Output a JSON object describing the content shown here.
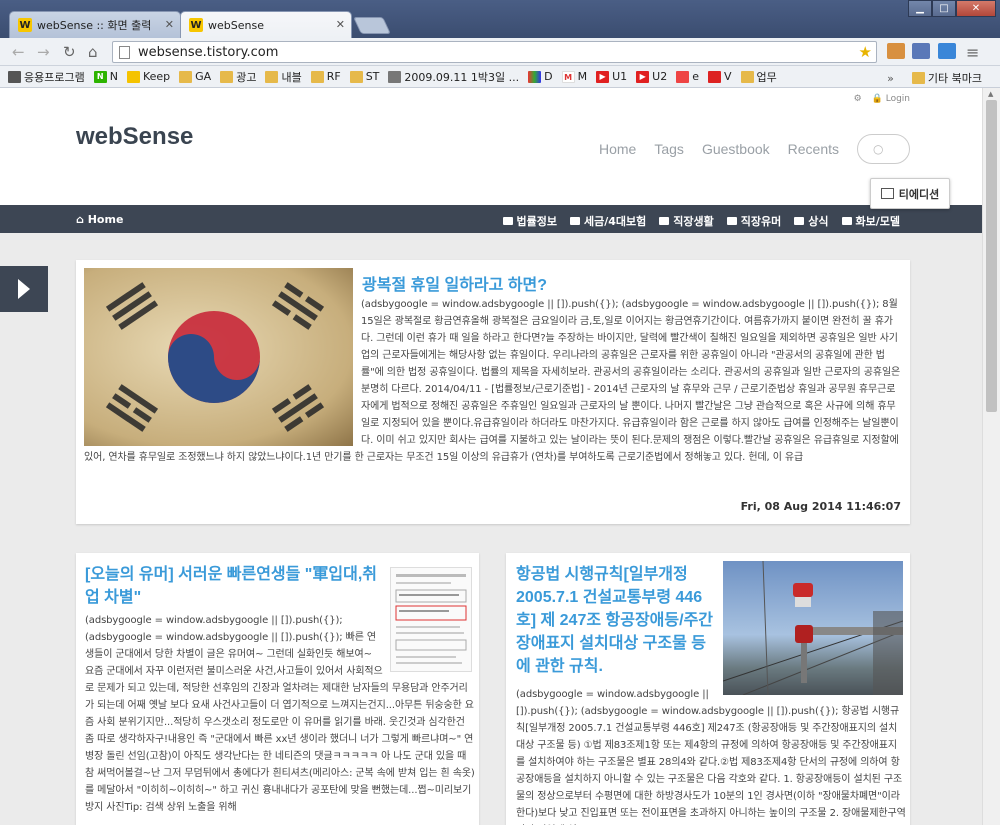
{
  "browser": {
    "tabs": [
      {
        "title": "webSense :: 화면 출력",
        "favicon": "W"
      },
      {
        "title": "webSense",
        "favicon": "W"
      }
    ],
    "url": "websense.tistory.com",
    "bookmarks": [
      "응용프로그램",
      "N",
      "Keep",
      "GA",
      "광고",
      "내블",
      "RF",
      "ST",
      "2009.09.11 1박3일 ...",
      "D",
      "M",
      "U1",
      "U2",
      "e",
      "V",
      "업무"
    ],
    "other_bookmarks": "기타 북마크"
  },
  "site": {
    "login": "Login",
    "logo": "webSense",
    "nav": [
      "Home",
      "Tags",
      "Guestbook",
      "Recents"
    ],
    "tedition": "티에디션",
    "home_link": "Home",
    "categories": [
      "법률정보",
      "세금/4대보험",
      "직장생활",
      "직장유머",
      "상식",
      "화보/모델"
    ]
  },
  "posts": [
    {
      "title": "광복절 휴일 일하라고 하면?",
      "excerpt": "(adsbygoogle = window.adsbygoogle || []).push({}); (adsbygoogle = window.adsbygoogle || []).push({}); 8월15일은 광복절로 황금연휴올해 광복절은 금요일이라 금,토,일로 이어지는 황금연휴기간이다. 여름휴가까지 붙이면 완전히 꿀 휴가다. 그런데 이런 휴가 때 일을 하라고 한다면?늘 주장하는 바이지만, 달력에 빨간색이 칠해진 일요일을 제외하면 공휴일은 일반 사기업의 근로자들에게는 해당사항 없는 휴일이다. 우리나라의 공휴일은 근로자를 위한 공휴일이 아니라 \"관공서의 공휴일에 관한 법률\"에 의한 법정 공휴일이다. 법률의 제목을 자세히보라. 관공서의 공휴일이라는 소리다. 관공서의 공휴일과 일반 근로자의 공휴일은 분명히 다르다. 2014/04/11 - [법률정보/근로기준법] - 2014년 근로자의 날 휴무와 근무 / 근로기준법상 휴일과 공무원 휴무근로자에게 법적으로 정해진 공휴일은 주휴일인 일요일과 근로자의 날 뿐이다. 나머지 빨간날은 그냥 관습적으로 혹은 사규에 의해 휴무일로 지정되어 있을 뿐이다.유급휴일이라 하더라도 마찬가지다. 유급휴일이라 함은 근로를 하지 않아도 급여를 인정해주는 날일뿐이다. 이미 쉬고 있지만 회사는 급여를 지불하고 있는 날이라는 뜻이 된다.문제의 쟁점은 이렇다.빨간날 공휴일은 유급휴일로 지정할에 있어, 연차를 휴무일로 조정했느냐 하지 않았느냐이다.1년 만기를 한 근로자는 무조건 15일 이상의 유급휴가 (연차)를 부여하도록 근로기준법에서 정해놓고 있다. 헌데, 이 유급",
      "date": "Fri, 08 Aug 2014 11:46:07"
    },
    {
      "title": "[오늘의 유머] 서러운 빠른연생들 \"軍입대,취업 차별\"",
      "excerpt": "(adsbygoogle = window.adsbygoogle || []).push({}); (adsbygoogle = window.adsbygoogle || []).push({}); 빠른 연생들이 군대에서 당한 차별이 글은 유머여~ 그런데 실화인듯 해보여~ 요즘 군대에서 자꾸 이런저런 불미스러운 사건,사고들이 있어서 사회적으로 문제가 되고 있는데, 적당한 선후임의 긴장과 얼차려는 제대한 남자들의 무용담과 안주거리가 되는데 어째 옛날 보다 요새 사건사고들이 더 엽기적으로 느껴지는건지...아무튼 뒤숭숭한 요즘 사회 분위기지만...적당히 우스갯소리 정도로만 이 유머를 읽기를 바래. 웃긴것과 심각한건 좀 따로 생각하자구!내용인 즉 \"군대에서 빠른 xx년 생이라 했더니 너가 그렇게 빠르냐며~\" 연병장 돌린 선임(고참)이 아직도 생각난다는 한 네티즌의 댓글ㅋㅋㅋㅋㅋ 아 나도 군대 있을 때 참 써먹어볼걸~난 그저 무덤뒤에서 총에다가 흰티셔츠(메리아스: 군복 속에 받쳐 입는 흰 속옷)를 메달아서 \"이히히~이히히~\" 하고 귀신 흉내내다가 공포탄에 맞을 뻔했는데...쩝~미리보기 방지 사진Tip: 검색 상위 노출을 위해"
    },
    {
      "title": "항공법 시행규칙[일부개정 2005.7.1 건설교통부령 446호] 제 247조 항공장애등/주간장애표지 설치대상 구조물 등에 관한 규칙.",
      "excerpt": "(adsbygoogle = window.adsbygoogle || []).push({}); (adsbygoogle = window.adsbygoogle || []).push({}); 항공법 시행규칙[일부개정 2005.7.1 건설교통부령 446호] 제247조 (항공장애등 및 주간장애표지의 설치대상 구조물 등) ①법 제83조제1항 또는 제4항의 규정에 의하여 항공장애등 및 주간장애표지를 설치하여야 하는 구조물은 별표 28의4와 같다.②법 제83조제4항 단서의 규정에 의하여 항공장애등을 설치하지 아니할 수 있는 구조물은 다음 각호와 같다. 1. 항공장애등이 설치된 구조물의 정상으로부터 수평면에 대한 하방경사도가 10분의 1인 경사면(이하 \"장애물차폐면\"이라 한다)보다 낮고 진입표면 또는 전이표면을 초과하지 아니하는 높이의 구조물 2. 장애물제한구역이외 지역에 설"
    }
  ]
}
